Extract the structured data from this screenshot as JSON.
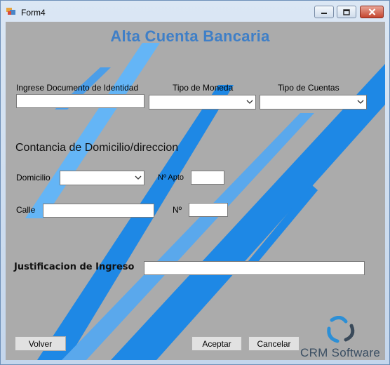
{
  "window": {
    "title": "Form4",
    "controls": {
      "minimize": "minimize",
      "maximize": "maximize",
      "close": "close"
    }
  },
  "form": {
    "heading": "Alta Cuenta Bancaria",
    "documento": {
      "label": "Ingrese Documento de Identidad",
      "value": ""
    },
    "moneda": {
      "label": "Tipo de Moneda",
      "selected": ""
    },
    "cuentas": {
      "label": "Tipo de Cuentas",
      "selected": ""
    },
    "domicilio_section": "Contancia de Domicilio/direccion",
    "domicilio": {
      "label": "Domicilio",
      "selected": ""
    },
    "apto": {
      "label": "Nº Apto",
      "value": ""
    },
    "calle": {
      "label": "Calle",
      "value": ""
    },
    "numero": {
      "label": "Nº",
      "value": ""
    },
    "justificacion": {
      "label": "Justificacion de Ingreso",
      "value": ""
    }
  },
  "buttons": {
    "volver": "Volver",
    "aceptar": "Aceptar",
    "cancelar": "Cancelar"
  },
  "branding": {
    "logo_text": "CRM Software"
  },
  "colors": {
    "heading": "#3f7fc7",
    "background": "#ababab",
    "stripe_dark": "#1e88e5",
    "stripe_light": "#64b5f6"
  },
  "icons": {
    "app": "form-app-icon",
    "combo": "chevron-down-icon",
    "logo": "crm-logo-icon"
  }
}
